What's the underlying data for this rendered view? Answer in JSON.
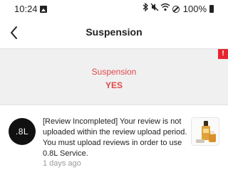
{
  "status_bar": {
    "time": "10:24",
    "battery": "100%",
    "icons": [
      "gallery-icon",
      "bluetooth-icon",
      "mute-icon",
      "wifi-icon",
      "do-not-disturb-icon",
      "battery-icon"
    ]
  },
  "header": {
    "title": "Suspension",
    "back_icon": "chevron-left-icon"
  },
  "banner": {
    "alert_mark": "!",
    "label": "Suspension",
    "value": "YES",
    "accent_color": "#e0474a",
    "alert_color": "#e5262f"
  },
  "notice": {
    "avatar_text": ".8L",
    "message": "[Review Incompleted] Your review is not uploaded within the review upload period. You must upload reviews in order to use 0.8L Service.",
    "time": "1 days ago",
    "thumbnail_icon": "product-bottles-icon"
  }
}
